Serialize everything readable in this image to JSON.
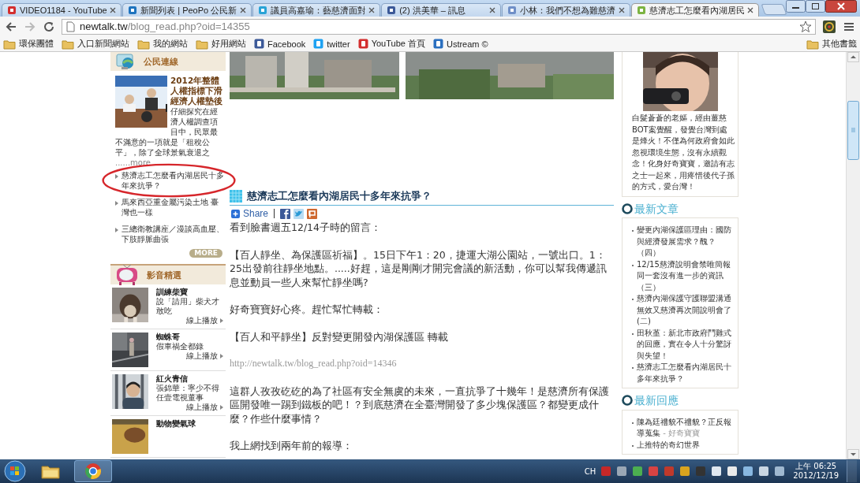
{
  "browser": {
    "tabs": [
      {
        "title": "VIDEO1184 - YouTube",
        "selected": false
      },
      {
        "title": "新聞列表 | PeoPo 公民新",
        "selected": false
      },
      {
        "title": "議員高嘉瑜：藝慈濟面對",
        "selected": false
      },
      {
        "title": "(2) 洪美華 – 訊息",
        "selected": false
      },
      {
        "title": "小林：我們不想為難慈濟",
        "selected": false
      },
      {
        "title": "慈濟志工怎麼看內湖居民",
        "selected": true
      }
    ],
    "address": {
      "host": "newtalk.tw",
      "path": "/blog_read.php?oid=14355"
    },
    "bookmarks": [
      {
        "label": "環保團體",
        "kind": "folder"
      },
      {
        "label": "入口新聞網站",
        "kind": "folder"
      },
      {
        "label": "我的網站",
        "kind": "folder"
      },
      {
        "label": "好用網站",
        "kind": "folder"
      },
      {
        "label": "Facebook",
        "kind": "site"
      },
      {
        "label": "twitter",
        "kind": "site"
      },
      {
        "label": "YouTube 首頁",
        "kind": "site"
      },
      {
        "label": "Ustream ©",
        "kind": "site"
      }
    ],
    "other_bookmarks": "其他書籤"
  },
  "left": {
    "citizen": {
      "heading": "公民連線",
      "feature": {
        "title": "2012年整體人權指標下滑經濟人權墊後",
        "summary": "仔細探究在經濟人權調查項目中，民眾最不滿意的一項就是「租稅公平」，除了全球景氣衰退之",
        "more": "......more"
      },
      "links": [
        {
          "text": "慈濟志工怎麼看內湖居民十多年來抗爭？",
          "circled": true
        },
        {
          "text": "馬來西亞重金屬污染土地 臺灣也一樣",
          "circled": false
        },
        {
          "text": "三總衛教講座／漫談高血壓、下肢靜脈曲張",
          "circled": false
        }
      ],
      "more_button": "MORE"
    },
    "videos": {
      "heading": "影音精選",
      "items": [
        {
          "title": "訓練柴寶",
          "desc": "說「請用」柴犬才敢吃",
          "play": "線上播放"
        },
        {
          "title": "蜘蛛哥",
          "desc": "假車禍全都錄",
          "play": "線上播放"
        },
        {
          "title": "紅火青信",
          "desc": "張錦華：寧少不得任壹電視董事",
          "play": "線上播放"
        },
        {
          "title": "動物變氣球"
        }
      ]
    }
  },
  "article": {
    "title": "慈濟志工怎麼看內湖居民十多年來抗爭？",
    "share": "Share",
    "body": [
      {
        "kind": "text",
        "text": " 看到臉書週五12/14子時的留言："
      },
      {
        "kind": "text",
        "text": "【百人靜坐、為保護區祈福】。15日下午1：20，捷運大湖公園站，一號出口。1：25出發前往靜坐地點。.....好趕，這是剛剛才開完會議的新活動，你可以幫我傳遞訊息並動員一些人來幫忙靜坐嗎?"
      },
      {
        "kind": "text",
        "text": "好奇寶寶好心疼。趕忙幫忙轉載："
      },
      {
        "kind": "text",
        "text": "【百人和平靜坐】反對變更開發內湖保護區 轉載"
      },
      {
        "kind": "link",
        "text": "http://newtalk.tw/blog_read.php?oid=14346"
      },
      {
        "kind": "text",
        "text": "這群人孜孜矻矻的為了社區有安全無虞的未來，一直抗爭了十幾年！是慈濟所有保護區開發唯一踢到鐵板的吧！？到底慈濟在全臺灣開發了多少塊保護區？都變更成什麼？作些什麼事情？"
      },
      {
        "kind": "text",
        "text": "我上網找到兩年前的報導："
      }
    ]
  },
  "right": {
    "profile": "白髮蒼蒼的老嫗，經由薑慈BOT案覺醒，發覺台灣到處是烽火！不僅為何政府會如此忽視環境生態，沒有永續觀念！化身好奇寶寶，邀請有志之士一起來，用疼惜後代子孫的方式，愛台灣！",
    "latest_heading": "最新文章",
    "latest": [
      "變更內湖保護區理由：國防與經濟發展需求？醜？（四）",
      "12/15慈濟說明會禁唯簡報同一套沒有進一步的資訊（三）",
      "慈濟內湖保護守護聯盟溝通無效又慈濟再次開說明會了(二)",
      "田秋堇：新北市政府鬥雞式的回應，實在令人十分驚訝與失望！",
      "慈濟志工怎麼看內湖居民十多年來抗爭？"
    ],
    "replies_heading": "最新回應",
    "replies": [
      {
        "text": "陳為廷禮貌不禮貌？正反報導蒐集",
        "author": " - 好奇寶寶"
      },
      {
        "text": "上推特的奇幻世界"
      }
    ]
  },
  "taskbar": {
    "language": "CH",
    "time": "上午 06:25",
    "date": "2012/12/19"
  }
}
